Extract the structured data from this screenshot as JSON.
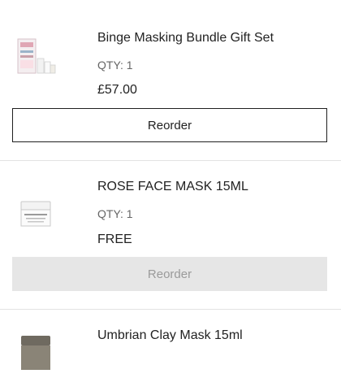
{
  "orders": [
    {
      "name": "Binge Masking Bundle Gift Set",
      "qty": "QTY: 1",
      "price": "£57.00",
      "reorder_label": "Reorder",
      "reorder_enabled": true
    },
    {
      "name": "ROSE FACE MASK 15ML",
      "qty": "QTY: 1",
      "price": "FREE",
      "reorder_label": "Reorder",
      "reorder_enabled": false
    },
    {
      "name": "Umbrian Clay Mask 15ml",
      "qty": "",
      "price": "",
      "reorder_label": "",
      "reorder_enabled": false
    }
  ],
  "icons": {
    "item1": "gift-set-product-image",
    "item2": "rose-face-mask-jar-image",
    "item3": "clay-mask-jar-image"
  },
  "colors": {
    "text": "#1f1f1f",
    "muted": "#666666",
    "disabled_bg": "#e6e6e6",
    "disabled_text": "#9a9a9a",
    "divider": "#e3e3e3"
  }
}
